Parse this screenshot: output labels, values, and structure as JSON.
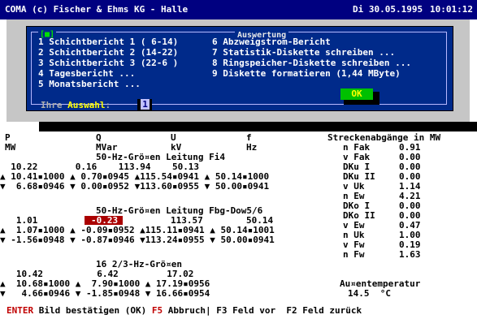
{
  "header": {
    "title": "COMA (c) Fischer & Ehms KG - Halle",
    "date": "Di 30.05.1995",
    "time": "10:01:12"
  },
  "dialog": {
    "title": "Auswertung",
    "close_glyph": "[■]",
    "items_left": [
      "1 Schichtbericht 1 ( 6-14)",
      "2 Schichtbericht 2 (14-22)",
      "3 Schichtbericht 3 (22-6 )",
      "4 Tagesbericht ...",
      "5 Monatsbericht ..."
    ],
    "items_right": [
      "6 Abzweigstrom-Bericht",
      "7 Statistik-Diskette schreiben ...",
      "8 Ringspeicher-Diskette schreiben ...",
      "9 Diskette formatieren (1,44 MByte)"
    ],
    "prompt_pre": "Ihre ",
    "prompt_hl": "Auswahl",
    "prompt_post": ":",
    "input_value": "1",
    "ok_label": "OK"
  },
  "table": {
    "headers": [
      "P",
      "Q",
      "U",
      "f"
    ],
    "units": [
      "MW",
      "MVar",
      "kV",
      "Hz"
    ],
    "group1_title": "50-Hz-Grö¤en Leitung Fi4",
    "group1_rows": [
      [
        "  10.22",
        "    0.16",
        "    113.94",
        "    50.13"
      ],
      [
        "▲ 10.41▪1000 ▲",
        " 0.70▪0945 ▲115.54▪0941 ▲",
        " 50.14▪1000",
        ""
      ],
      [
        "▼  6.68▪0946 ▼",
        " 0.00▪0952 ▼113.60▪0955 ▼",
        " 50.00▪0941",
        ""
      ]
    ],
    "group2_title": "50-Hz-Grö¤en Leitung Fbg-Dow5/6",
    "group2_row1": [
      "   1.01",
      "-0.23",
      "113.57",
      "50.14"
    ],
    "group2_rows": [
      "▲  1.07▪1000 ▲ -0.09▪0952 ▲115.11▪0941 ▲ 50.14▪1001",
      "▼ -1.56▪0948 ▼ -0.87▪0946 ▼113.24▪0955 ▼ 50.00▪0941"
    ],
    "group3_title": "16 2/3-Hz-Grö¤en",
    "group3_rows": [
      "   10.42          6.42         17.02",
      "▲  10.68▪1000 ▲  7.90▪1000 ▲ 17.19▪0956",
      "▼   4.66▪0946 ▼ -1.85▪0948 ▼ 16.66▪0954"
    ]
  },
  "right_panel": {
    "title": "Streckenabgänge in MW",
    "rows": [
      [
        "n Fak",
        "0.91"
      ],
      [
        "v Fak",
        "0.00"
      ],
      [
        "DKu I",
        "0.00"
      ],
      [
        "DKu II",
        "0.00"
      ],
      [
        "v Uk",
        "1.14"
      ],
      [
        "n Ew",
        "4.21"
      ],
      [
        "DKo I",
        "0.00"
      ],
      [
        "DKo II",
        "0.00"
      ],
      [
        "v Ew",
        "0.47"
      ],
      [
        "n Uk",
        "1.00"
      ],
      [
        "v Fw",
        "0.19"
      ],
      [
        "n Fw",
        "1.63"
      ]
    ],
    "temp_label": "Au¤entemperatur",
    "temp_value": "14.5",
    "temp_unit": "°C"
  },
  "status": {
    "k1": "ENTER",
    "t1": " Bild bestätigen (OK) ",
    "k2": "F5",
    "t2": " Abbruch| F3 Feld vor  F2 Feld zurück"
  },
  "colors": {
    "header_bg": "#000080",
    "dialog_bg": "#002a8a",
    "ok_bg": "#00c000",
    "highlight_red": "#aa0000"
  }
}
